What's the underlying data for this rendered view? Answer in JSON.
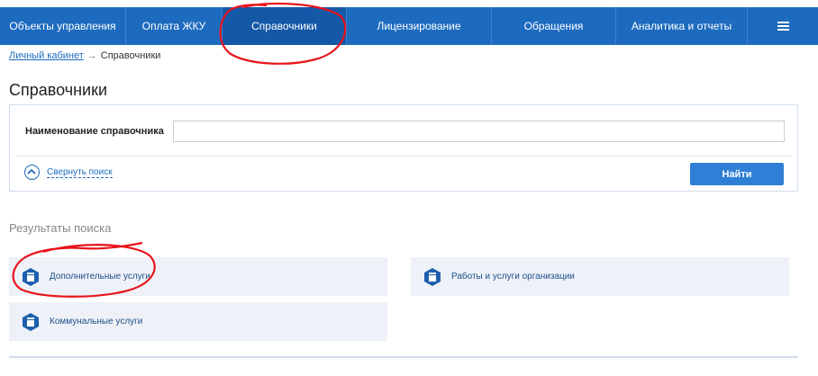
{
  "nav": {
    "items": [
      {
        "label": "Объекты управления"
      },
      {
        "label": "Оплата ЖКУ"
      },
      {
        "label": "Справочники"
      },
      {
        "label": "Лицензирование"
      },
      {
        "label": "Обращения"
      },
      {
        "label": "Аналитика и отчеты"
      }
    ],
    "menu_icon": "hamburger-menu-icon",
    "active_index": 2,
    "color": "#1d6bbf",
    "active_color": "#1458a8"
  },
  "breadcrumb": {
    "home_label": "Личный кабинет",
    "separator": "→",
    "current": "Справочники"
  },
  "page": {
    "title": "Справочники"
  },
  "search": {
    "field_label": "Наименование справочника",
    "field_value": "",
    "collapse_label": "Свернуть поиск",
    "find_label": "Найти",
    "accent": "#2f7fd6"
  },
  "results": {
    "title": "Результаты поиска",
    "items": [
      {
        "label": "Дополнительные услуги",
        "icon": "catalog-icon"
      },
      {
        "label": "Работы и услуги организации",
        "icon": "catalog-icon"
      },
      {
        "label": "Коммунальные услуги",
        "icon": "catalog-icon"
      }
    ]
  },
  "annotations": {
    "color": "#e8141b"
  }
}
